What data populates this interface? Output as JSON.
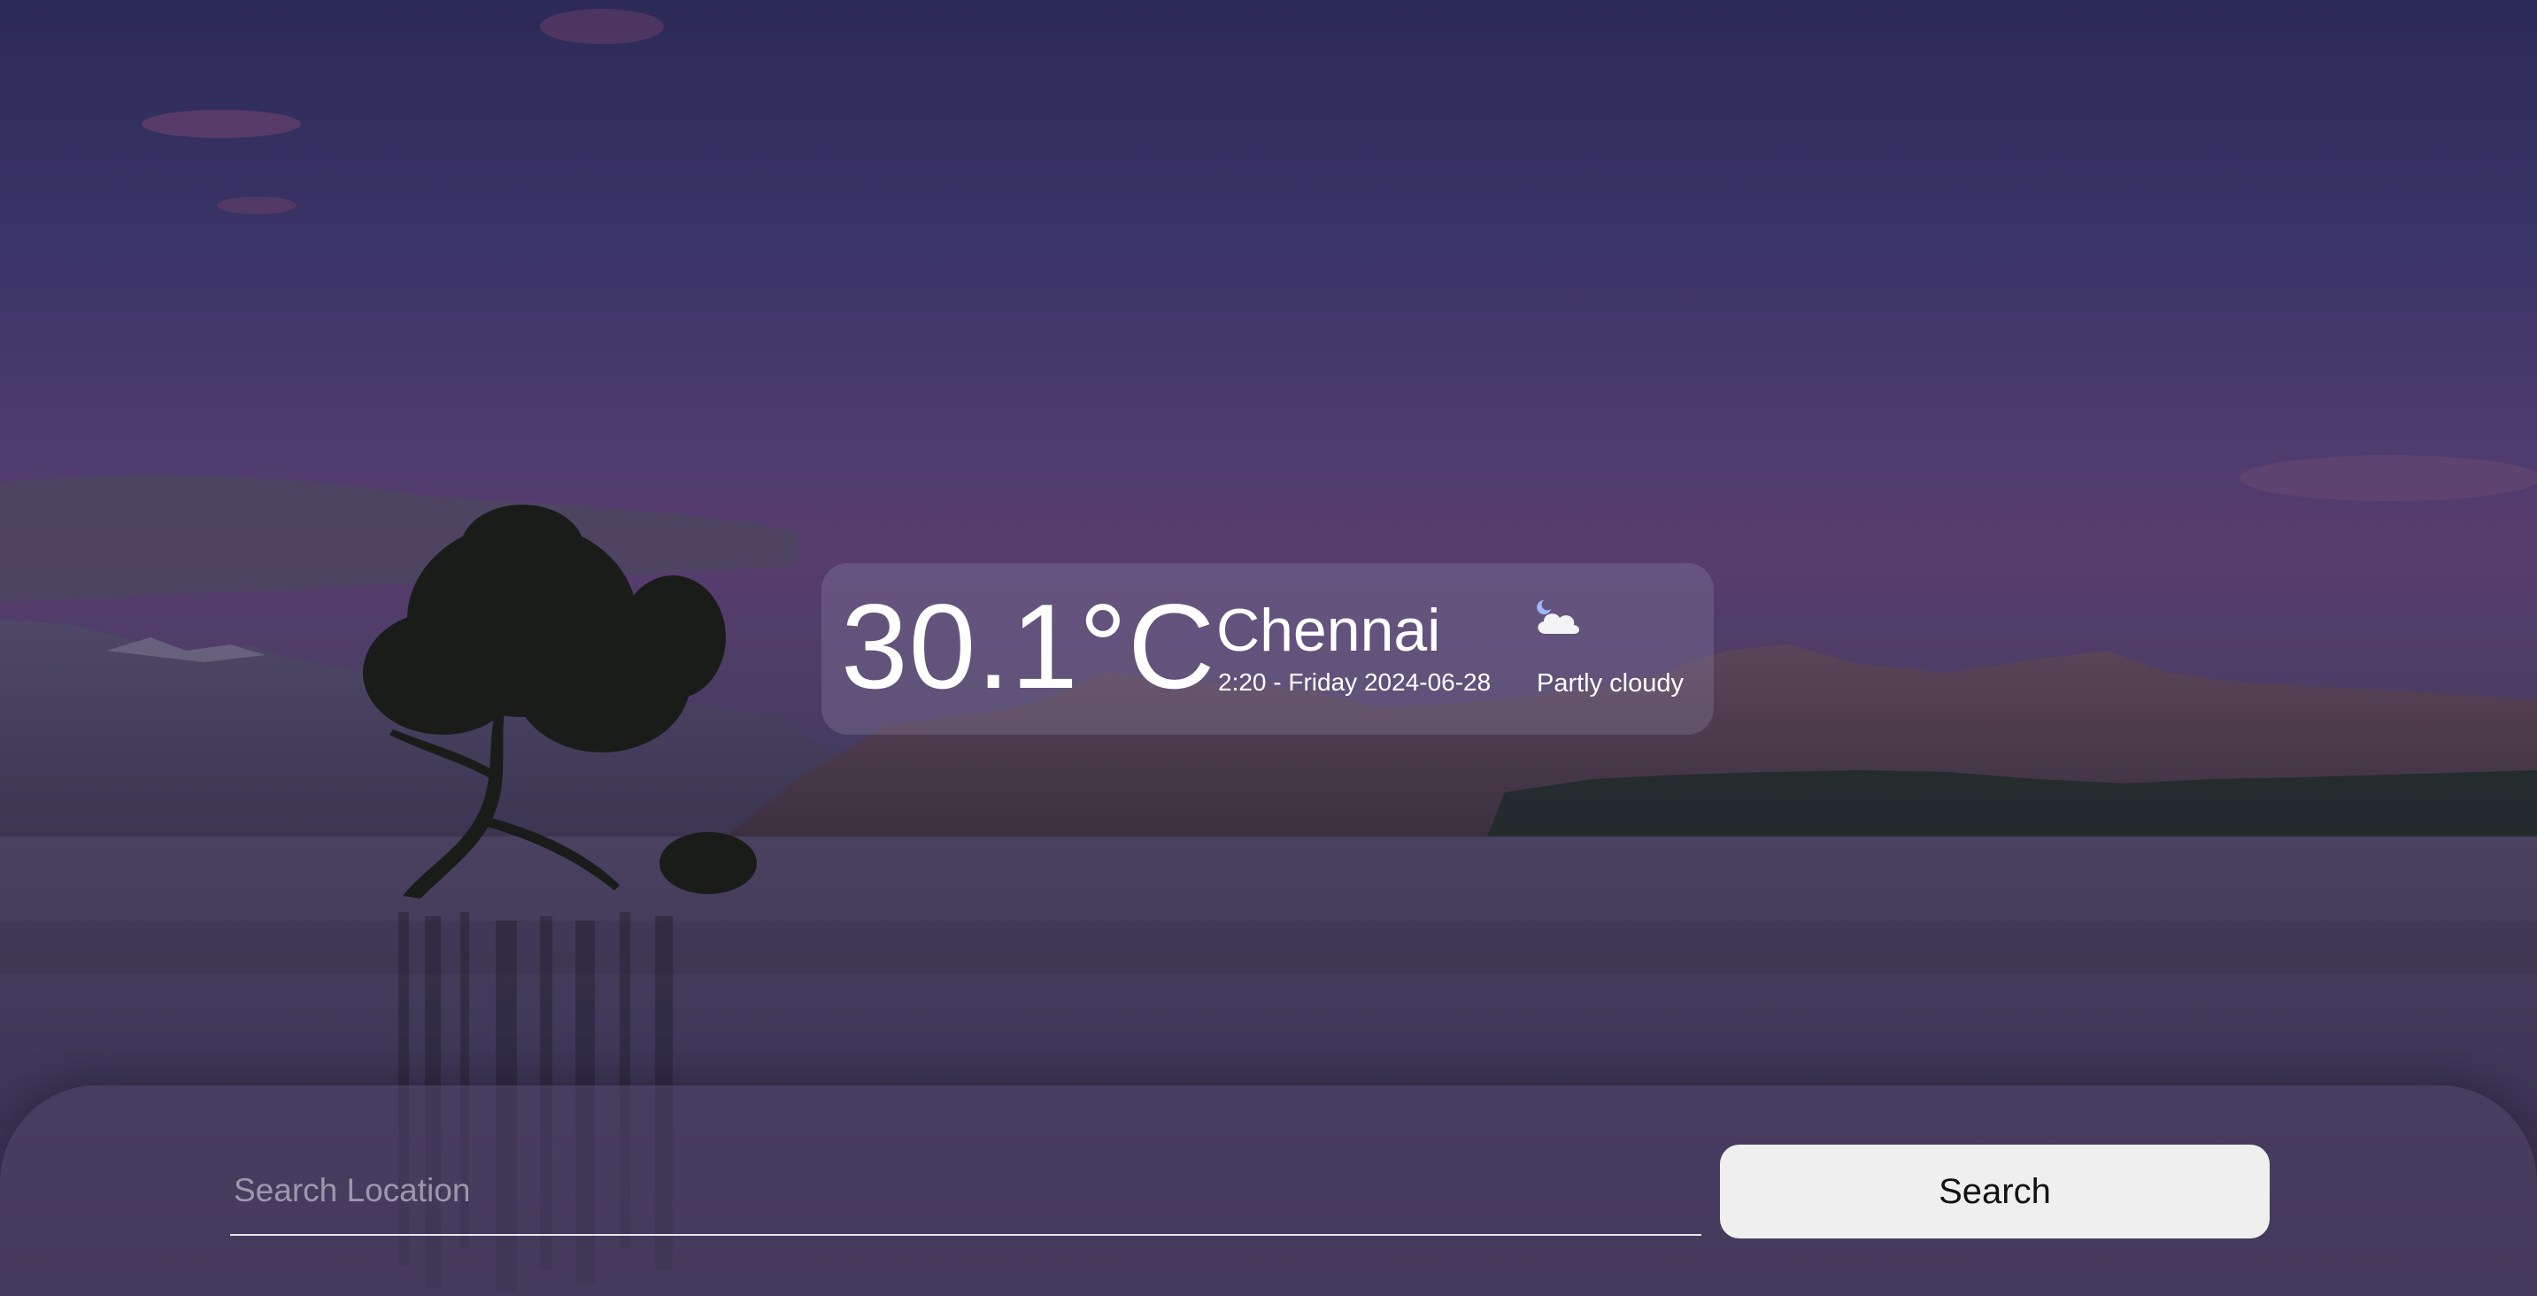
{
  "weather": {
    "temperature": "30.1°C",
    "city": "Chennai",
    "datetime": "2:20 - Friday 2024-06-28",
    "condition_text": "Partly cloudy",
    "condition_icon": "partly-cloudy-night-icon"
  },
  "search": {
    "placeholder": "Search Location",
    "value": "",
    "button_label": "Search"
  },
  "colors": {
    "sky_top": "#2c2a57",
    "sky_mid": "#573d6e",
    "lake": "#3a3352",
    "card": "#968caf",
    "button": "#efeff0"
  }
}
